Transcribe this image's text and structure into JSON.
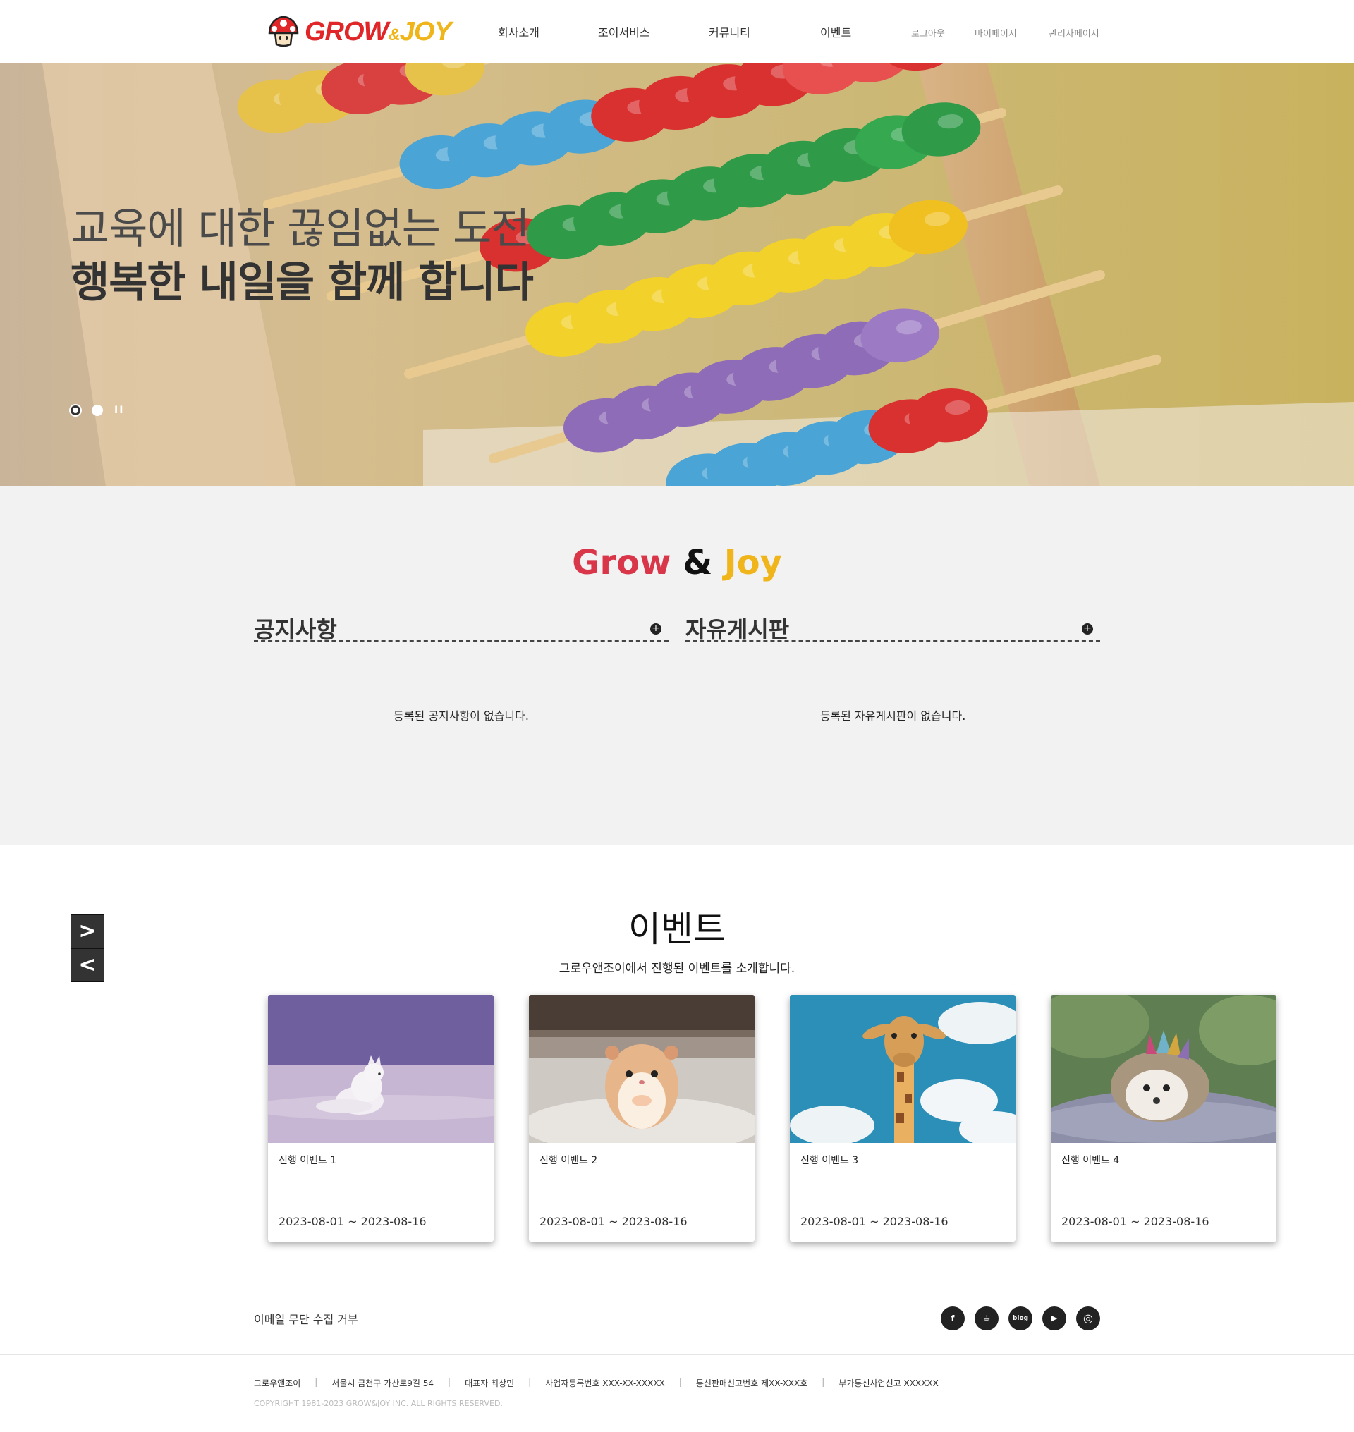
{
  "header": {
    "logo": {
      "grow": "GROW",
      "amp": "&",
      "joy": "JOY"
    },
    "nav": [
      "회사소개",
      "조이서비스",
      "커뮤니티",
      "이벤트"
    ],
    "util": [
      "로그아웃",
      "마이페이지",
      "관리자페이지"
    ]
  },
  "hero": {
    "line1": "교육에 대한 끊임없는 도전",
    "line2": "행복한 내일을 함께 합니다",
    "pause": "II",
    "active_slide": 1,
    "slide_count": 2
  },
  "brand": {
    "grow": "Grow",
    "amp": "&",
    "joy": "Joy"
  },
  "boards": [
    {
      "title": "공지사항",
      "empty": "등록된 공지사항이 없습니다.",
      "plus": "+"
    },
    {
      "title": "자유게시판",
      "empty": "등록된 자유게시판이 없습니다.",
      "plus": "+"
    }
  ],
  "events": {
    "title": "이벤트",
    "subtitle": "그로우앤조이에서 진행된 이벤트를 소개합니다.",
    "next": ">",
    "prev": "<",
    "cards": [
      {
        "name": "진행 이벤트 1",
        "date": "2023-08-01 ~ 2023-08-16",
        "image": "arctic-fox"
      },
      {
        "name": "진행 이벤트 2",
        "date": "2023-08-01 ~ 2023-08-16",
        "image": "hamster"
      },
      {
        "name": "진행 이벤트 3",
        "date": "2023-08-01 ~ 2023-08-16",
        "image": "giraffe"
      },
      {
        "name": "진행 이벤트 4",
        "date": "2023-08-01 ~ 2023-08-16",
        "image": "hedgehog"
      }
    ]
  },
  "footer": {
    "no_email": "이메일 무단 수집 거부",
    "socials": [
      {
        "icon": "facebook-icon",
        "glyph": "f"
      },
      {
        "icon": "cafe-icon",
        "glyph": "☕"
      },
      {
        "icon": "blog-icon",
        "glyph": "blog"
      },
      {
        "icon": "youtube-icon",
        "glyph": "▶"
      },
      {
        "icon": "instagram-icon",
        "glyph": "◎"
      }
    ],
    "biz": [
      "그로우앤조이",
      "서울시 금천구 가산로9길 54",
      "대표자 최상민",
      "사업자등록번호 XXX-XX-XXXXX",
      "통신판매신고번호 제XX-XXX호",
      "부가통신사업신고 XXXXXX"
    ],
    "copyright": "COPYRIGHT 1981-2023 GROW&JOY INC. ALL RIGHTS RESERVED."
  },
  "colors": {
    "grow_red": "#d9364a",
    "joy_yellow": "#f0b51a",
    "board_bg": "#f2f2f2",
    "dark": "#333333"
  }
}
